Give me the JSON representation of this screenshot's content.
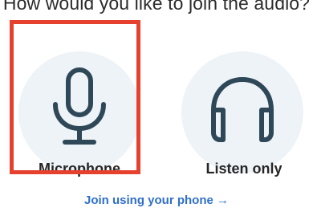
{
  "dialog": {
    "prompt": "How would you like to join the audio?",
    "options": [
      {
        "label": "Microphone",
        "icon": "microphone-icon",
        "selected": true
      },
      {
        "label": "Listen only",
        "icon": "headphones-icon",
        "selected": false
      }
    ],
    "phone_link": "Join using your phone →"
  },
  "colors": {
    "highlight": "#e6412f",
    "icon_stroke": "#2f4858",
    "circle_bg": "#eef3f8",
    "link": "#2f6fca",
    "text": "#262626"
  }
}
